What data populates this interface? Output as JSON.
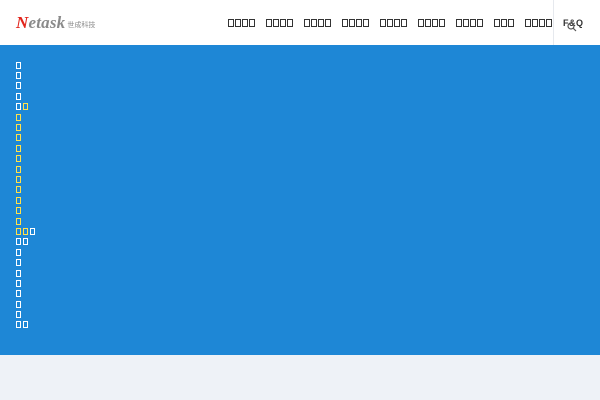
{
  "header": {
    "logo_text_n": "N",
    "logo_text_rest": "etask",
    "logo_sub": "世成科技",
    "nav": [
      {
        "label": "□□□□",
        "glyphs": 4
      },
      {
        "label": "□□□□",
        "glyphs": 4
      },
      {
        "label": "□□□□",
        "glyphs": 4
      },
      {
        "label": "□□□□",
        "glyphs": 4
      },
      {
        "label": "□□□□",
        "glyphs": 4
      },
      {
        "label": "□□□□",
        "glyphs": 4
      },
      {
        "label": "□□□□",
        "glyphs": 4
      },
      {
        "label": "□□□",
        "glyphs": 3
      },
      {
        "label": "□□□□",
        "glyphs": 4
      },
      {
        "label": "F&Q",
        "glyphs": 0
      }
    ],
    "search_icon": "search-icon"
  },
  "banner": {
    "bg_color": "#1e87d6",
    "rows": [
      [
        "w"
      ],
      [
        "w"
      ],
      [
        "w"
      ],
      [
        "w"
      ],
      [
        "w",
        "y"
      ],
      [
        "y"
      ],
      [
        "y"
      ],
      [
        "y"
      ],
      [
        "y"
      ],
      [
        "y"
      ],
      [
        "y"
      ],
      [
        "y"
      ],
      [
        "y"
      ],
      [
        "y"
      ],
      [
        "y"
      ],
      [
        "y"
      ],
      [
        "y",
        "y",
        "w"
      ],
      [
        "w",
        "w"
      ],
      [
        "w"
      ],
      [
        "w"
      ],
      [
        "w"
      ],
      [
        "w"
      ],
      [
        "w"
      ],
      [
        "w"
      ],
      [
        "w"
      ],
      [
        "w",
        "w"
      ]
    ]
  },
  "colors": {
    "accent_red": "#e2231a",
    "banner_blue": "#1e87d6",
    "glyph_yellow": "#ffe14a"
  }
}
